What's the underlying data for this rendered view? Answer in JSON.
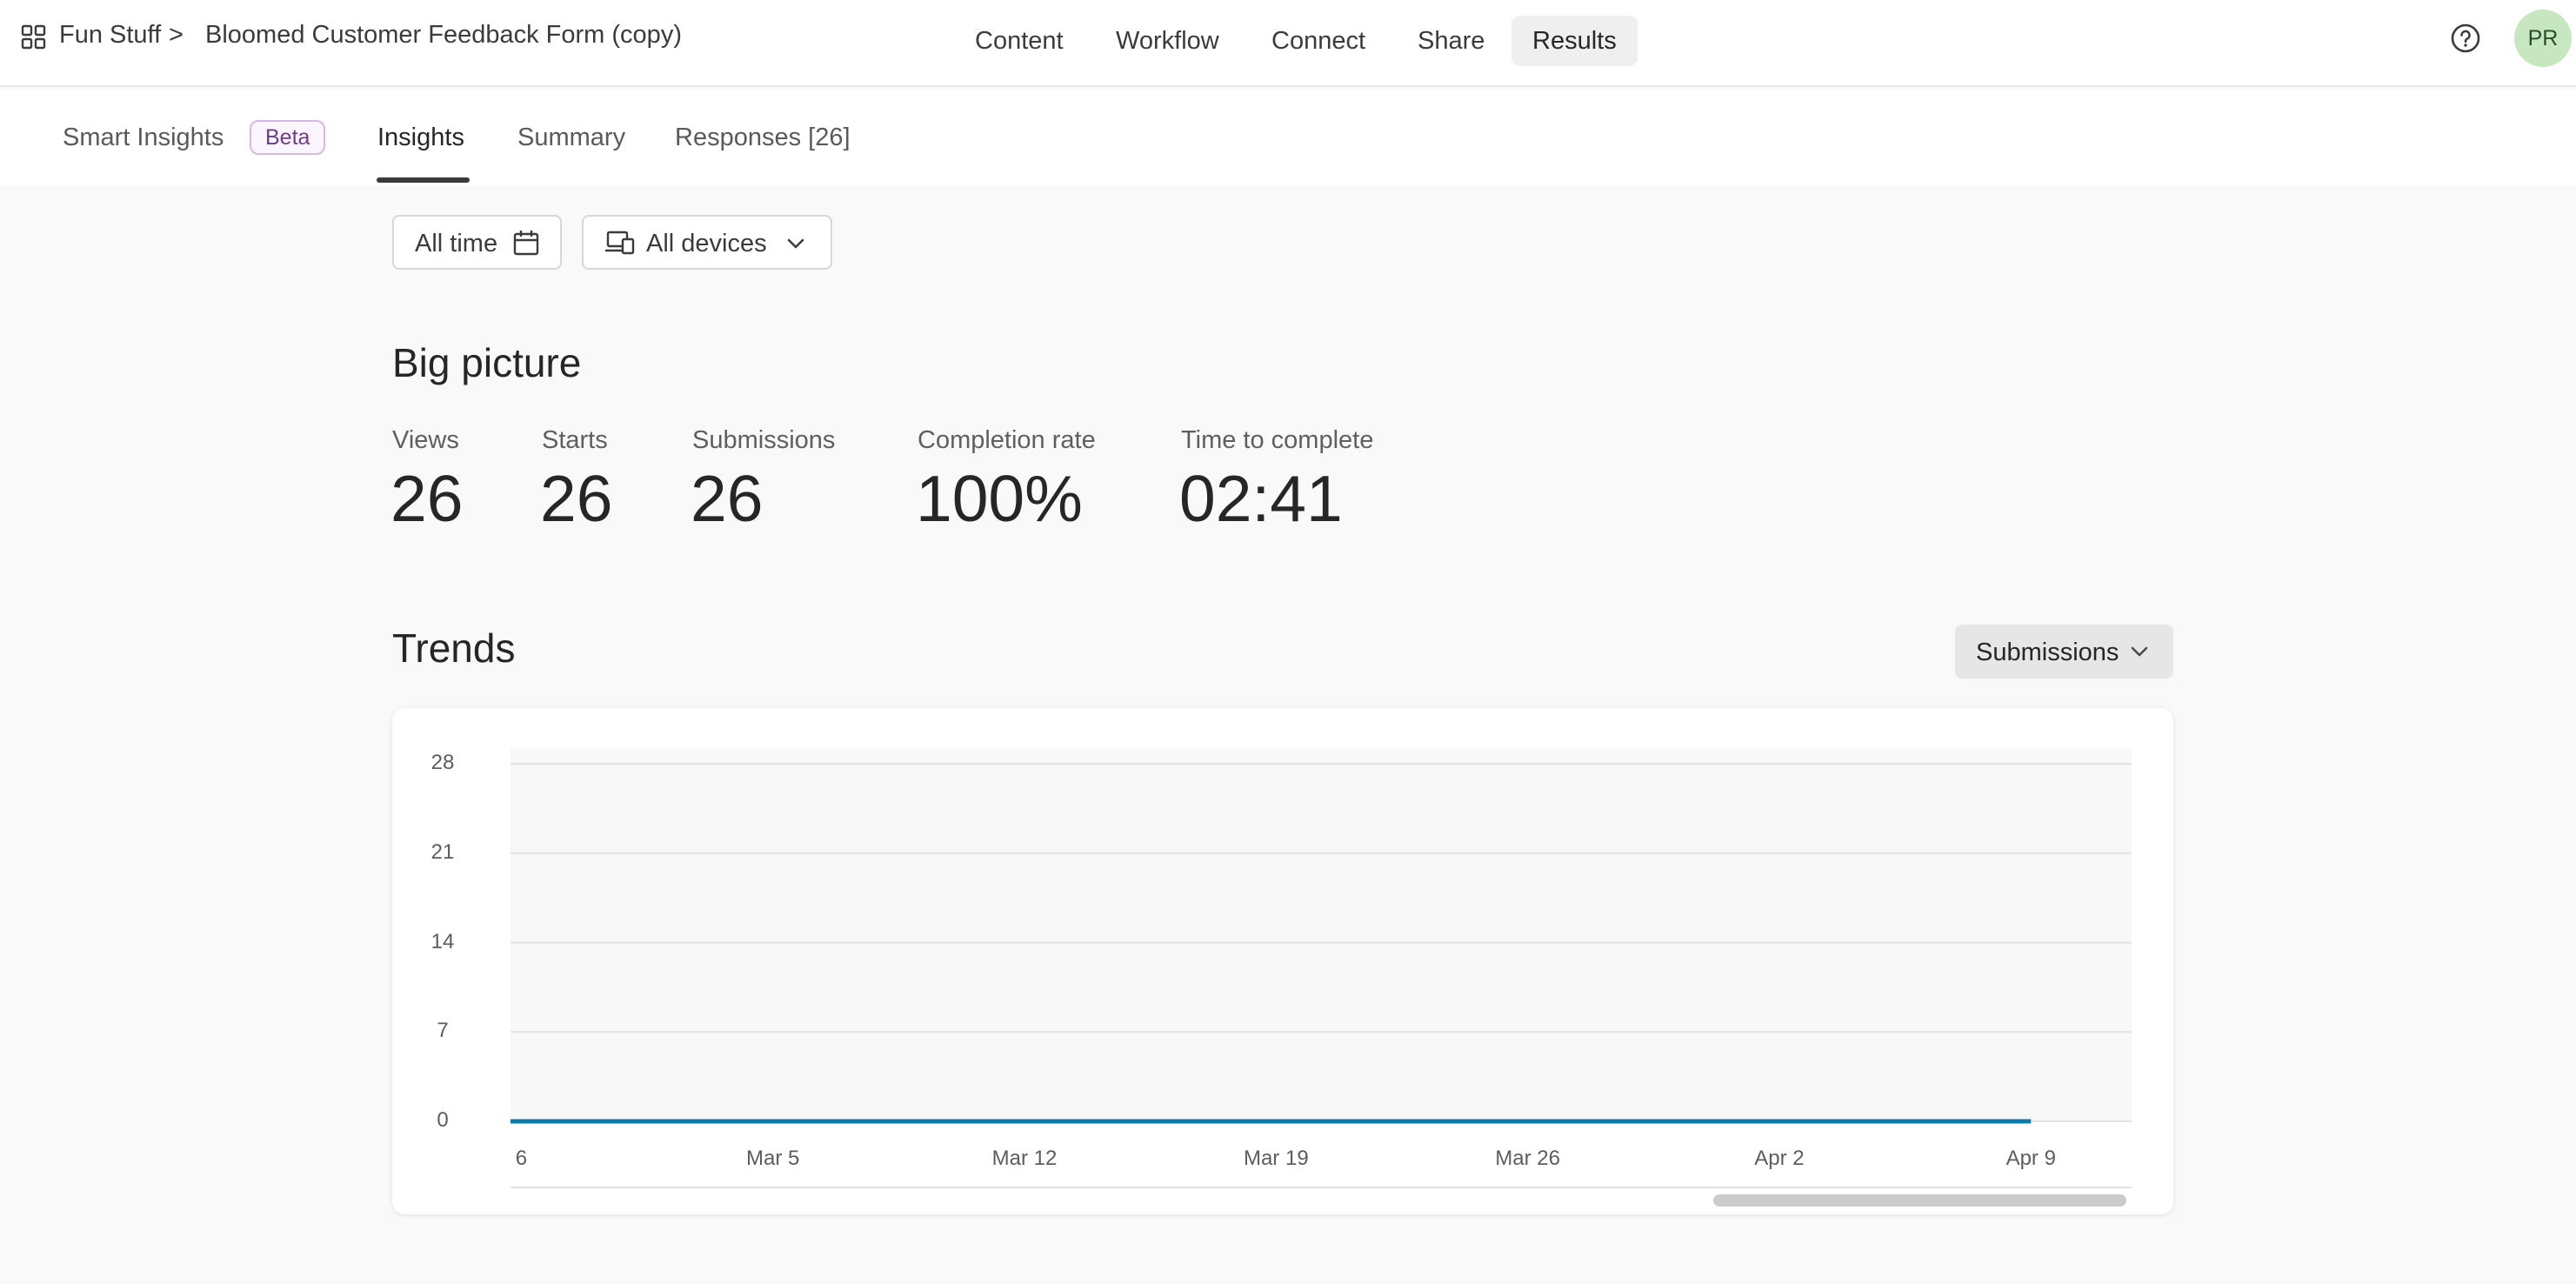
{
  "header": {
    "workspace": "Fun Stuff",
    "separator": ">",
    "form_title": "Bloomed Customer Feedback Form (copy)",
    "nav": [
      "Content",
      "Workflow",
      "Connect",
      "Share",
      "Results"
    ],
    "active_nav": "Results",
    "avatar_initials": "PR",
    "icons": {
      "apps": "grid-icon",
      "help": "help-circle-icon"
    }
  },
  "subnav": {
    "tabs": [
      "Smart Insights",
      "Insights",
      "Summary",
      "Responses [26]"
    ],
    "beta_badge": "Beta",
    "active_tab": "Insights"
  },
  "filters": {
    "time": "All time",
    "devices": "All devices",
    "icons": {
      "time": "calendar-icon",
      "devices": "devices-icon",
      "caret": "chevron-down-icon"
    }
  },
  "big_picture": {
    "title": "Big picture",
    "kpis": [
      {
        "label": "Views",
        "value": "26"
      },
      {
        "label": "Starts",
        "value": "26"
      },
      {
        "label": "Submissions",
        "value": "26"
      },
      {
        "label": "Completion rate",
        "value": "100%"
      },
      {
        "label": "Time to complete",
        "value": "02:41"
      }
    ]
  },
  "trends": {
    "title": "Trends",
    "metric_dropdown": "Submissions"
  },
  "chart_data": {
    "type": "line",
    "title": "",
    "xlabel": "",
    "ylabel": "",
    "y_ticks": [
      0,
      7,
      14,
      21,
      28
    ],
    "ylim": [
      0,
      28
    ],
    "x_tick_labels": [
      "6",
      "Mar 5",
      "Mar 12",
      "Mar 19",
      "Mar 26",
      "Apr 2",
      "Apr 9"
    ],
    "x_tick_days": [
      -1,
      6,
      13,
      20,
      27,
      34,
      41
    ],
    "x_range_days": [
      -1.3,
      43.8
    ],
    "series": [
      {
        "color": "#0b7bab",
        "x_days": [
          -1.3,
          41
        ],
        "values": [
          0,
          0
        ]
      }
    ],
    "grid": true
  }
}
